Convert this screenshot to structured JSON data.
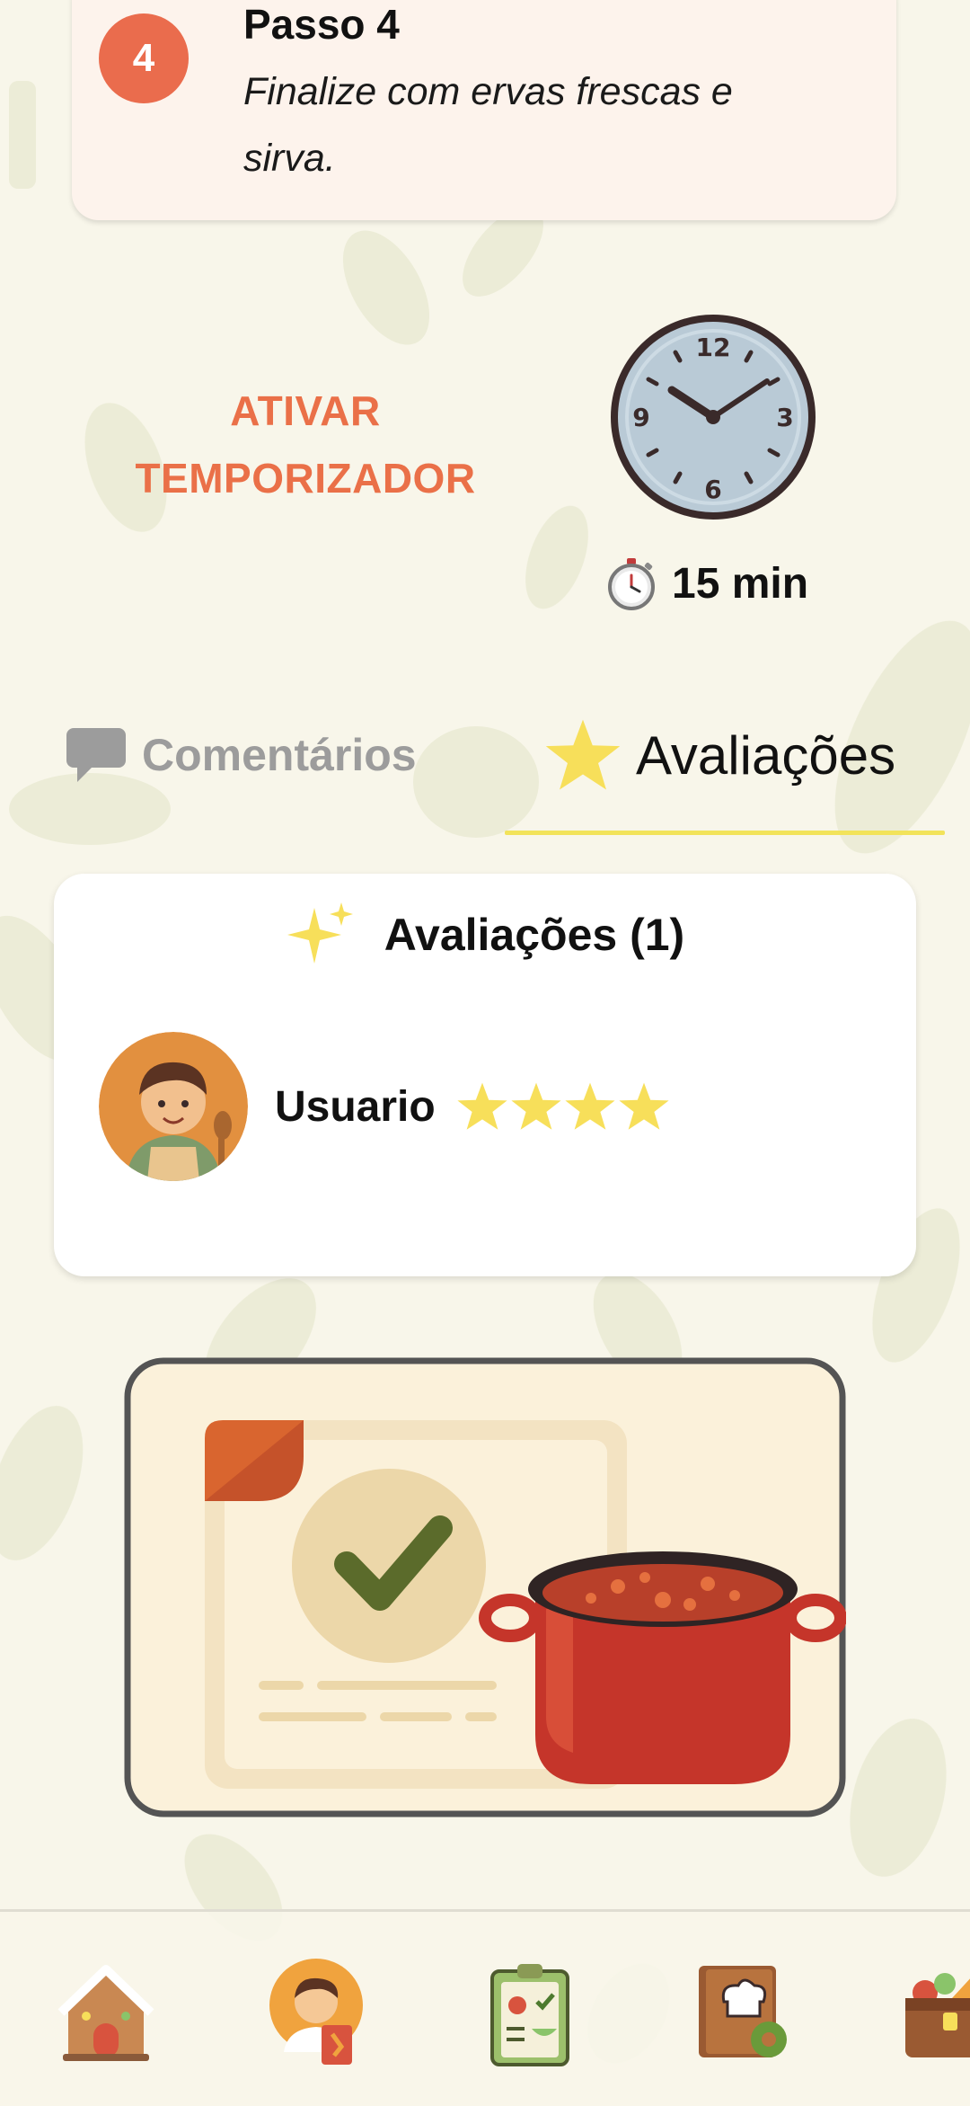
{
  "step": {
    "number": "4",
    "title": "Passo 4",
    "text": "Finalize com ervas frescas e sirva."
  },
  "timer": {
    "button_label": "ATIVAR TEMPORIZADOR",
    "duration": "15 min",
    "clock_icon": "analog-clock-icon",
    "stopwatch_icon": "stopwatch-icon"
  },
  "tabs": [
    {
      "label": "Comentários",
      "icon": "speech-bubble-icon",
      "active": false
    },
    {
      "label": "Avaliações",
      "icon": "star-icon",
      "active": true
    }
  ],
  "reviews": {
    "title": "Avaliações (1)",
    "icon": "sparkles-icon",
    "items": [
      {
        "user": "Usuario",
        "rating": 4,
        "avatar": "chef-avatar"
      }
    ]
  },
  "banner": {
    "icon": "recipe-done-pot-illustration"
  },
  "nav": [
    {
      "icon": "gingerbread-house-icon"
    },
    {
      "icon": "profile-chef-icon"
    },
    {
      "icon": "shopping-checklist-icon"
    },
    {
      "icon": "recipe-book-settings-icon"
    },
    {
      "icon": "treasure-chest-food-icon"
    }
  ],
  "colors": {
    "background": "#f8f6ea",
    "accent": "#ea6c4d",
    "star": "#f7df5a",
    "tab_inactive": "#9c9c9c"
  }
}
